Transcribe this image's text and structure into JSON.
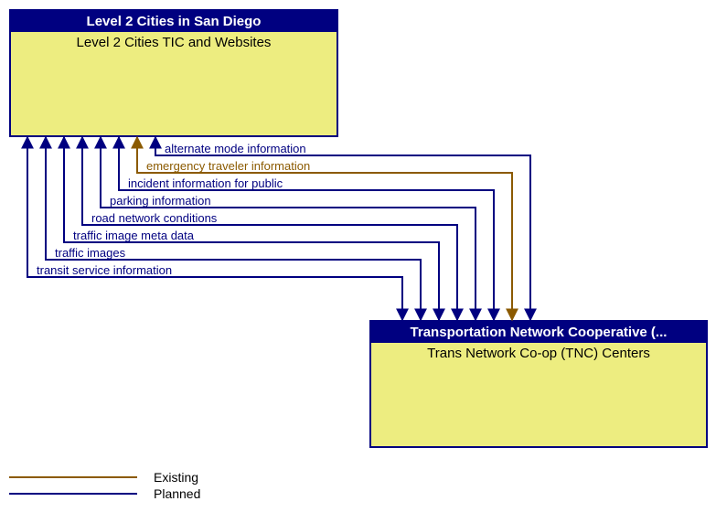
{
  "nodes": {
    "left": {
      "header": "Level 2 Cities in San Diego",
      "label": "Level 2 Cities TIC and Websites"
    },
    "right": {
      "header": "Transportation Network Cooperative (...",
      "label": "Trans Network Co-op (TNC) Centers"
    }
  },
  "flows": [
    {
      "name": "alternate mode information",
      "status": "planned"
    },
    {
      "name": "emergency traveler information",
      "status": "existing"
    },
    {
      "name": "incident information for public",
      "status": "planned"
    },
    {
      "name": "parking information",
      "status": "planned"
    },
    {
      "name": "road network conditions",
      "status": "planned"
    },
    {
      "name": "traffic image meta data",
      "status": "planned"
    },
    {
      "name": "traffic images",
      "status": "planned"
    },
    {
      "name": "transit service information",
      "status": "planned"
    }
  ],
  "legend": {
    "existing": "Existing",
    "planned": "Planned"
  },
  "colors": {
    "planned": "#000080",
    "existing": "#8B5A00"
  }
}
